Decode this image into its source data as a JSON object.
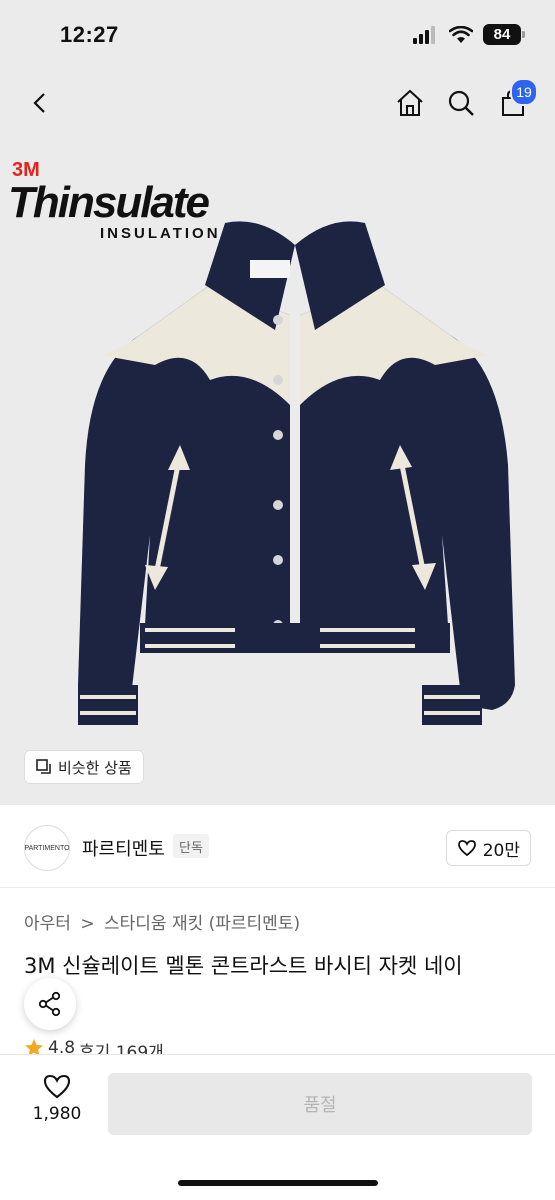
{
  "status_bar": {
    "time": "12:27",
    "battery": "84"
  },
  "nav": {
    "cart_count": "19"
  },
  "hero": {
    "brand_logo_3m": "3M",
    "brand_logo_name": "Thinsulate",
    "brand_logo_tagline": "INSULATION",
    "similar_label": "비슷한 상품"
  },
  "seller": {
    "avatar_text": "PARTIMENTO",
    "name": "파르티멘토",
    "badge": "단독",
    "likes": "20만"
  },
  "product": {
    "breadcrumb": [
      "아우터",
      ">",
      "스타디움 재킷 (파르티멘토)"
    ],
    "title": "3M 신슐레이트 멜톤 콘트라스트 바시티 자켓 네이",
    "rating": "4.8",
    "review_label": "후기 169개"
  },
  "bottom": {
    "wish_count": "1,980",
    "soldout_label": "품절"
  },
  "colors": {
    "accent": "#2f64f0",
    "jacket_navy": "#1c2442",
    "jacket_cream": "#ece8dc",
    "star": "#f5a623"
  }
}
